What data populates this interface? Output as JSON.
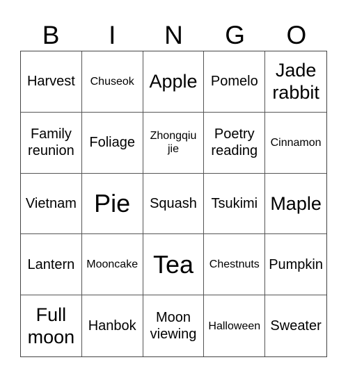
{
  "header": {
    "letters": [
      "B",
      "I",
      "N",
      "G",
      "O"
    ]
  },
  "grid": {
    "rows": [
      [
        {
          "text": "Harvest",
          "size": "md"
        },
        {
          "text": "Chuseok",
          "size": "sm"
        },
        {
          "text": "Apple",
          "size": "lg"
        },
        {
          "text": "Pomelo",
          "size": "md"
        },
        {
          "text": "Jade rabbit",
          "size": "lg"
        }
      ],
      [
        {
          "text": "Family reunion",
          "size": "md"
        },
        {
          "text": "Foliage",
          "size": "md"
        },
        {
          "text": "Zhongqiu jie",
          "size": "sm"
        },
        {
          "text": "Poetry reading",
          "size": "md"
        },
        {
          "text": "Cinnamon",
          "size": "sm"
        }
      ],
      [
        {
          "text": "Vietnam",
          "size": "md"
        },
        {
          "text": "Pie",
          "size": "xl"
        },
        {
          "text": "Squash",
          "size": "md"
        },
        {
          "text": "Tsukimi",
          "size": "md"
        },
        {
          "text": "Maple",
          "size": "lg"
        }
      ],
      [
        {
          "text": "Lantern",
          "size": "md"
        },
        {
          "text": "Mooncake",
          "size": "sm"
        },
        {
          "text": "Tea",
          "size": "xl"
        },
        {
          "text": "Chestnuts",
          "size": "sm"
        },
        {
          "text": "Pumpkin",
          "size": "md"
        }
      ],
      [
        {
          "text": "Full moon",
          "size": "lg"
        },
        {
          "text": "Hanbok",
          "size": "md"
        },
        {
          "text": "Moon viewing",
          "size": "md"
        },
        {
          "text": "Halloween",
          "size": "sm"
        },
        {
          "text": "Sweater",
          "size": "md"
        }
      ]
    ]
  }
}
